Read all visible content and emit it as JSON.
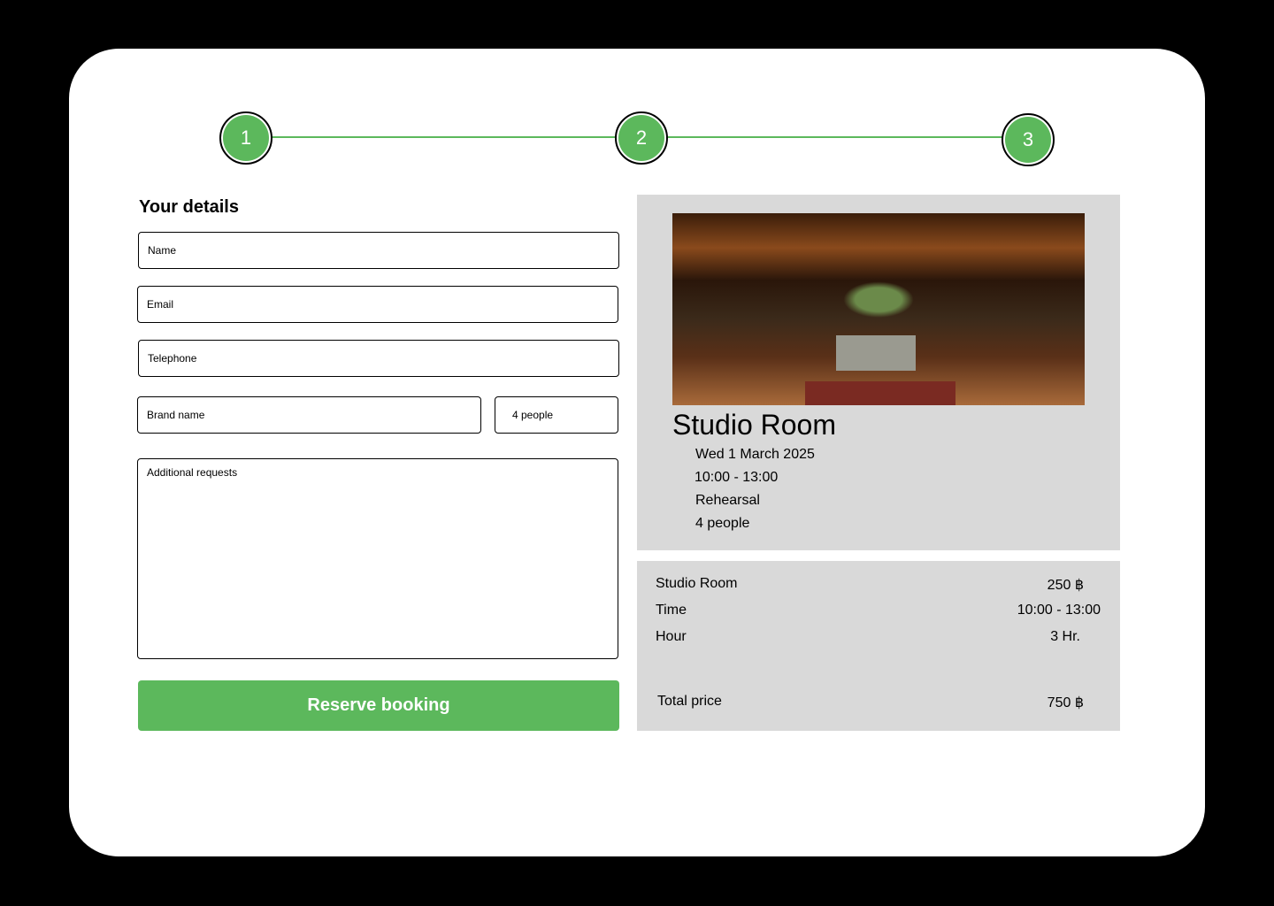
{
  "steps": [
    "1",
    "2",
    "3"
  ],
  "form": {
    "title": "Your details",
    "name": "Name",
    "email": "Email",
    "telephone": "Telephone",
    "brand": "Brand name",
    "people": "4 people",
    "requests": "Additional requests",
    "submit": "Reserve booking"
  },
  "booking": {
    "room": "Studio Room",
    "date": "Wed 1 March 2025",
    "time": "10:00 - 13:00",
    "type": "Rehearsal",
    "people": "4 people"
  },
  "summary": {
    "rows": [
      {
        "label": "Studio Room",
        "value": "250 ฿"
      },
      {
        "label": "Time",
        "value": "10:00 - 13:00"
      },
      {
        "label": "Hour",
        "value": "3 Hr."
      }
    ],
    "total_label": "Total price",
    "total_value": "750 ฿"
  }
}
